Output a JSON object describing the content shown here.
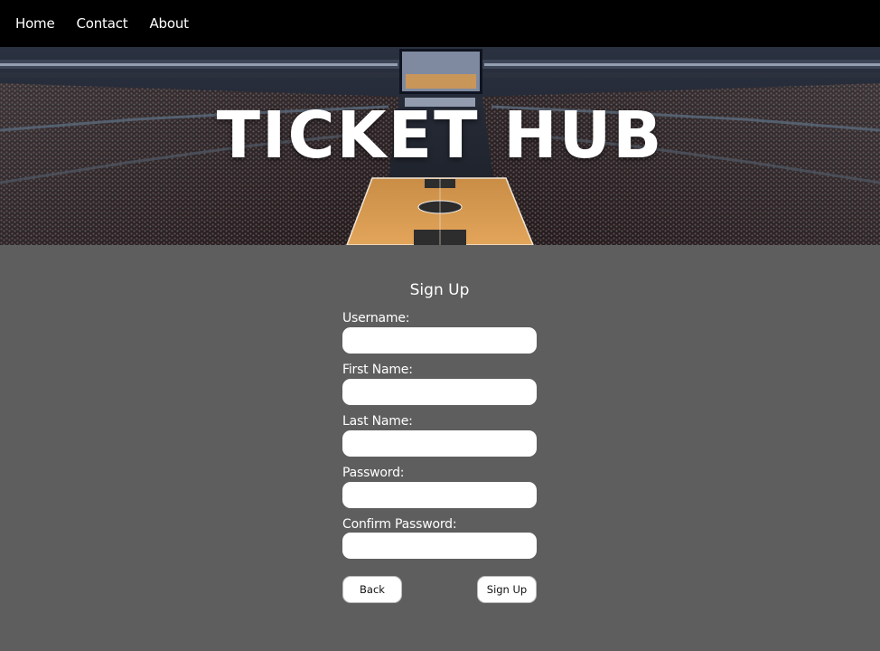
{
  "nav": {
    "links": [
      "Home",
      "Contact",
      "About"
    ]
  },
  "hero": {
    "title": "TICKET HUB"
  },
  "form": {
    "title": "Sign Up",
    "fields": [
      {
        "label": "Username:",
        "value": "",
        "placeholder": ""
      },
      {
        "label": "First Name:",
        "value": "",
        "placeholder": ""
      },
      {
        "label": "Last Name:",
        "value": "",
        "placeholder": ""
      },
      {
        "label": "Password:",
        "value": "",
        "placeholder": ""
      },
      {
        "label": "Confirm Password:",
        "value": "",
        "placeholder": ""
      }
    ],
    "back_label": "Back",
    "submit_label": "Sign Up"
  },
  "colors": {
    "nav_bg": "#000000",
    "page_bg": "#5e5e5e",
    "court": "#d99a4e"
  }
}
